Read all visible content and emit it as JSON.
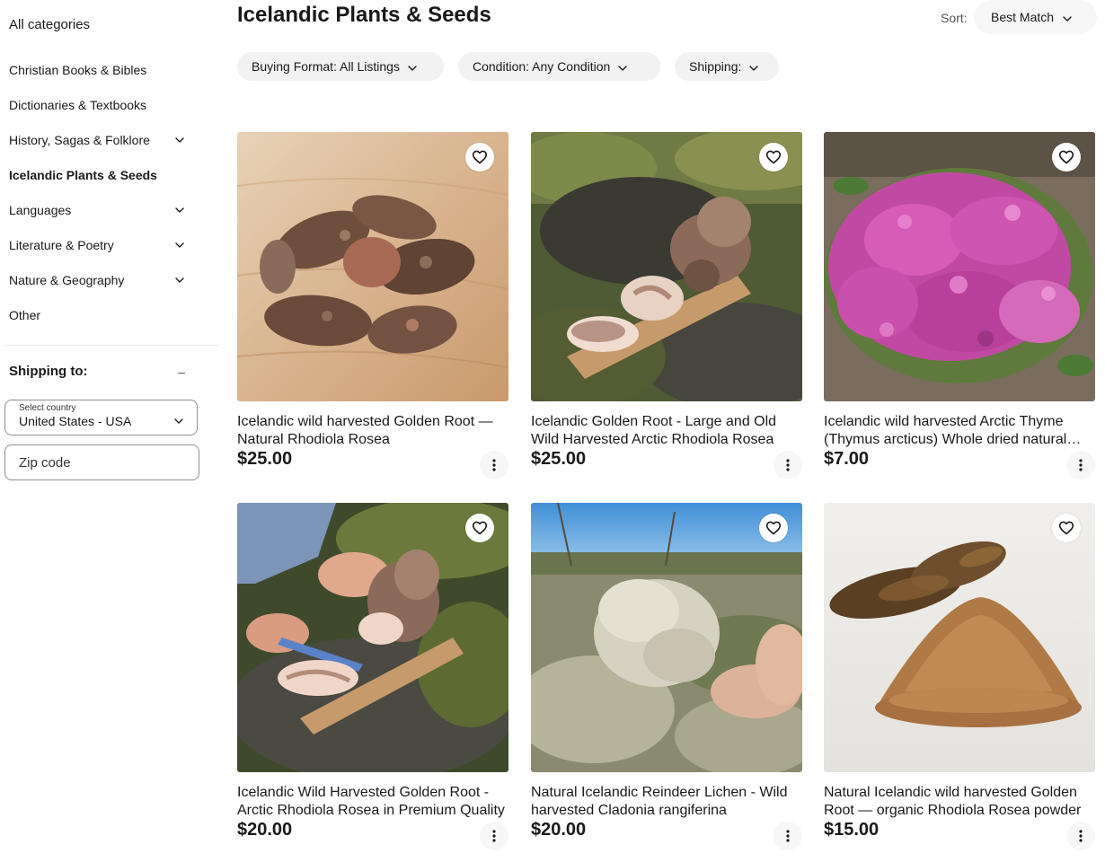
{
  "sidebar": {
    "heading": "All categories",
    "categories": [
      {
        "label": "Christian Books & Bibles",
        "has_children": false,
        "active": false
      },
      {
        "label": "Dictionaries & Textbooks",
        "has_children": false,
        "active": false
      },
      {
        "label": "History, Sagas & Folklore",
        "has_children": true,
        "active": false
      },
      {
        "label": "Icelandic Plants & Seeds",
        "has_children": false,
        "active": true
      },
      {
        "label": "Languages",
        "has_children": true,
        "active": false
      },
      {
        "label": "Literature & Poetry",
        "has_children": true,
        "active": false
      },
      {
        "label": "Nature & Geography",
        "has_children": true,
        "active": false
      },
      {
        "label": "Other",
        "has_children": false,
        "active": false
      }
    ],
    "shipping": {
      "heading": "Shipping to:",
      "collapse_symbol": "–",
      "country_label": "Select country",
      "country_value": "United States - USA",
      "zip_placeholder": "Zip code"
    }
  },
  "header": {
    "title": "Icelandic Plants & Seeds",
    "sort_label": "Sort:",
    "sort_value": "Best Match"
  },
  "filters": [
    {
      "label": "Buying Format: All Listings"
    },
    {
      "label": "Condition: Any Condition"
    },
    {
      "label": "Shipping:"
    }
  ],
  "listings": [
    {
      "title": "Icelandic wild harvested Golden Root — Natural Rhodiola Rosea",
      "price": "$25.00",
      "image": "golden-root-pieces"
    },
    {
      "title": "Icelandic Golden Root - Large and Old Wild Harvested Arctic Rhodiola Rosea",
      "price": "$25.00",
      "image": "golden-root-on-board"
    },
    {
      "title": "Icelandic wild harvested Arctic Thyme (Thymus arcticus) Whole dried natural herb",
      "price": "$7.00",
      "image": "arctic-thyme-flowers"
    },
    {
      "title": "Icelandic Wild Harvested Golden Root - Arctic Rhodiola Rosea in Premium Quality",
      "price": "$20.00",
      "image": "golden-root-cutting"
    },
    {
      "title": "Natural Icelandic Reindeer Lichen - Wild harvested Cladonia rangiferina",
      "price": "$20.00",
      "image": "reindeer-lichen-hand"
    },
    {
      "title": "Natural Icelandic wild harvested Golden Root — organic Rhodiola Rosea powder",
      "price": "$15.00",
      "image": "golden-root-powder"
    }
  ],
  "icons": {
    "heart": "heart-outline-icon",
    "more": "vertical-dots-icon",
    "chevron": "chevron-down-icon"
  }
}
